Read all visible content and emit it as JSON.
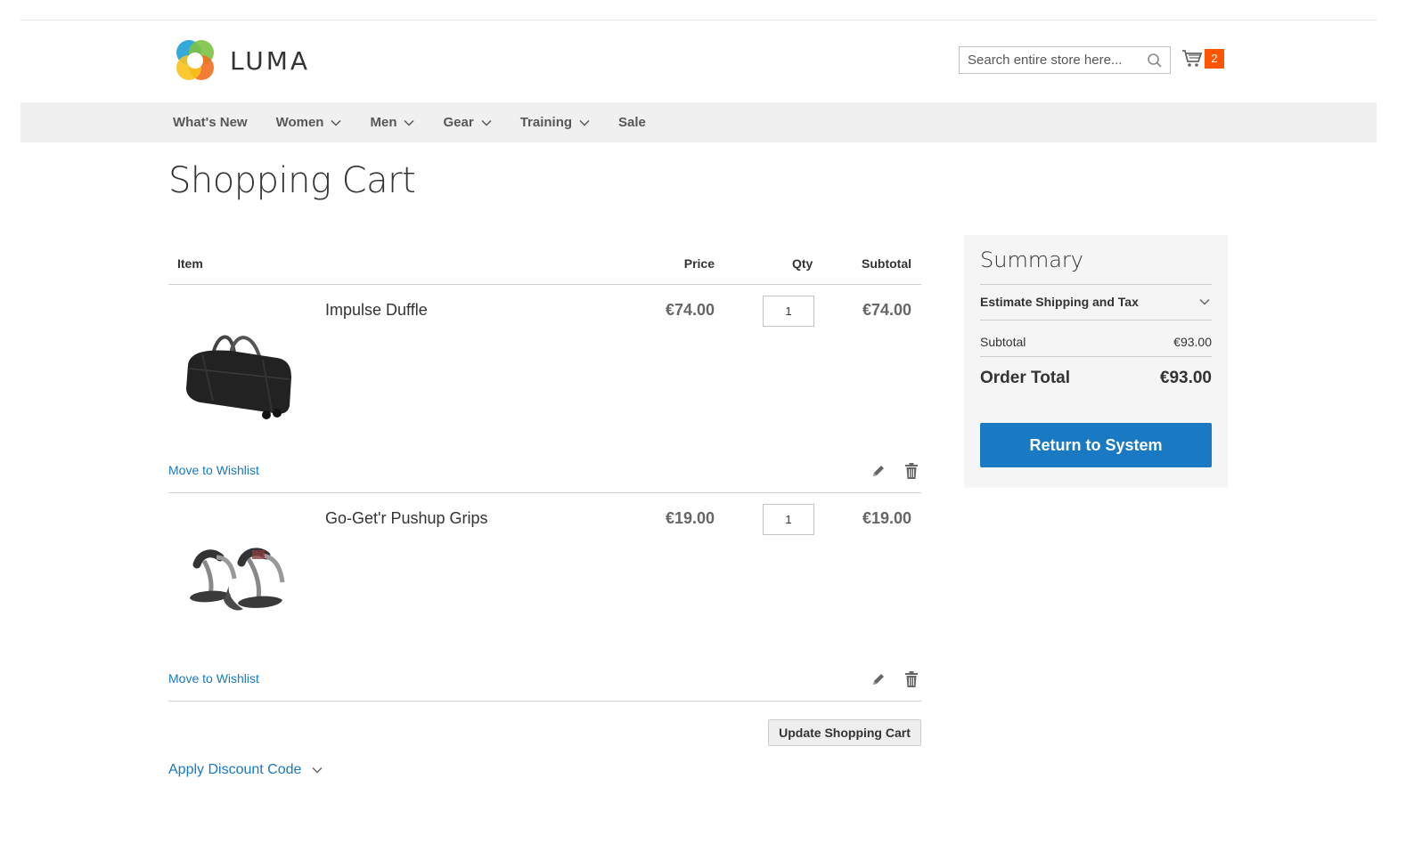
{
  "brand": {
    "name": "LUMA"
  },
  "header": {
    "search_placeholder": "Search entire store here...",
    "cart_count": "2"
  },
  "nav": {
    "items": [
      {
        "label": "What's New",
        "has_dropdown": false
      },
      {
        "label": "Women",
        "has_dropdown": true
      },
      {
        "label": "Men",
        "has_dropdown": true
      },
      {
        "label": "Gear",
        "has_dropdown": true
      },
      {
        "label": "Training",
        "has_dropdown": true
      },
      {
        "label": "Sale",
        "has_dropdown": false
      }
    ]
  },
  "page": {
    "title": "Shopping Cart"
  },
  "cart": {
    "columns": {
      "item": "Item",
      "price": "Price",
      "qty": "Qty",
      "subtotal": "Subtotal"
    },
    "items": [
      {
        "name": "Impulse Duffle",
        "price": "€74.00",
        "qty": "1",
        "subtotal": "€74.00",
        "wishlist_label": "Move to Wishlist"
      },
      {
        "name": "Go-Get'r Pushup Grips",
        "price": "€19.00",
        "qty": "1",
        "subtotal": "€19.00",
        "wishlist_label": "Move to Wishlist"
      }
    ],
    "update_label": "Update Shopping Cart",
    "discount_label": "Apply Discount Code"
  },
  "summary": {
    "title": "Summary",
    "estimate_label": "Estimate Shipping and Tax",
    "subtotal_label": "Subtotal",
    "subtotal_value": "€93.00",
    "total_label": "Order Total",
    "total_value": "€93.00",
    "return_label": "Return to System"
  },
  "colors": {
    "accent": "#1979c3",
    "cart_badge": "#ff5501",
    "nav_bg": "#f0f0f0",
    "summary_bg": "#f5f5f5"
  }
}
